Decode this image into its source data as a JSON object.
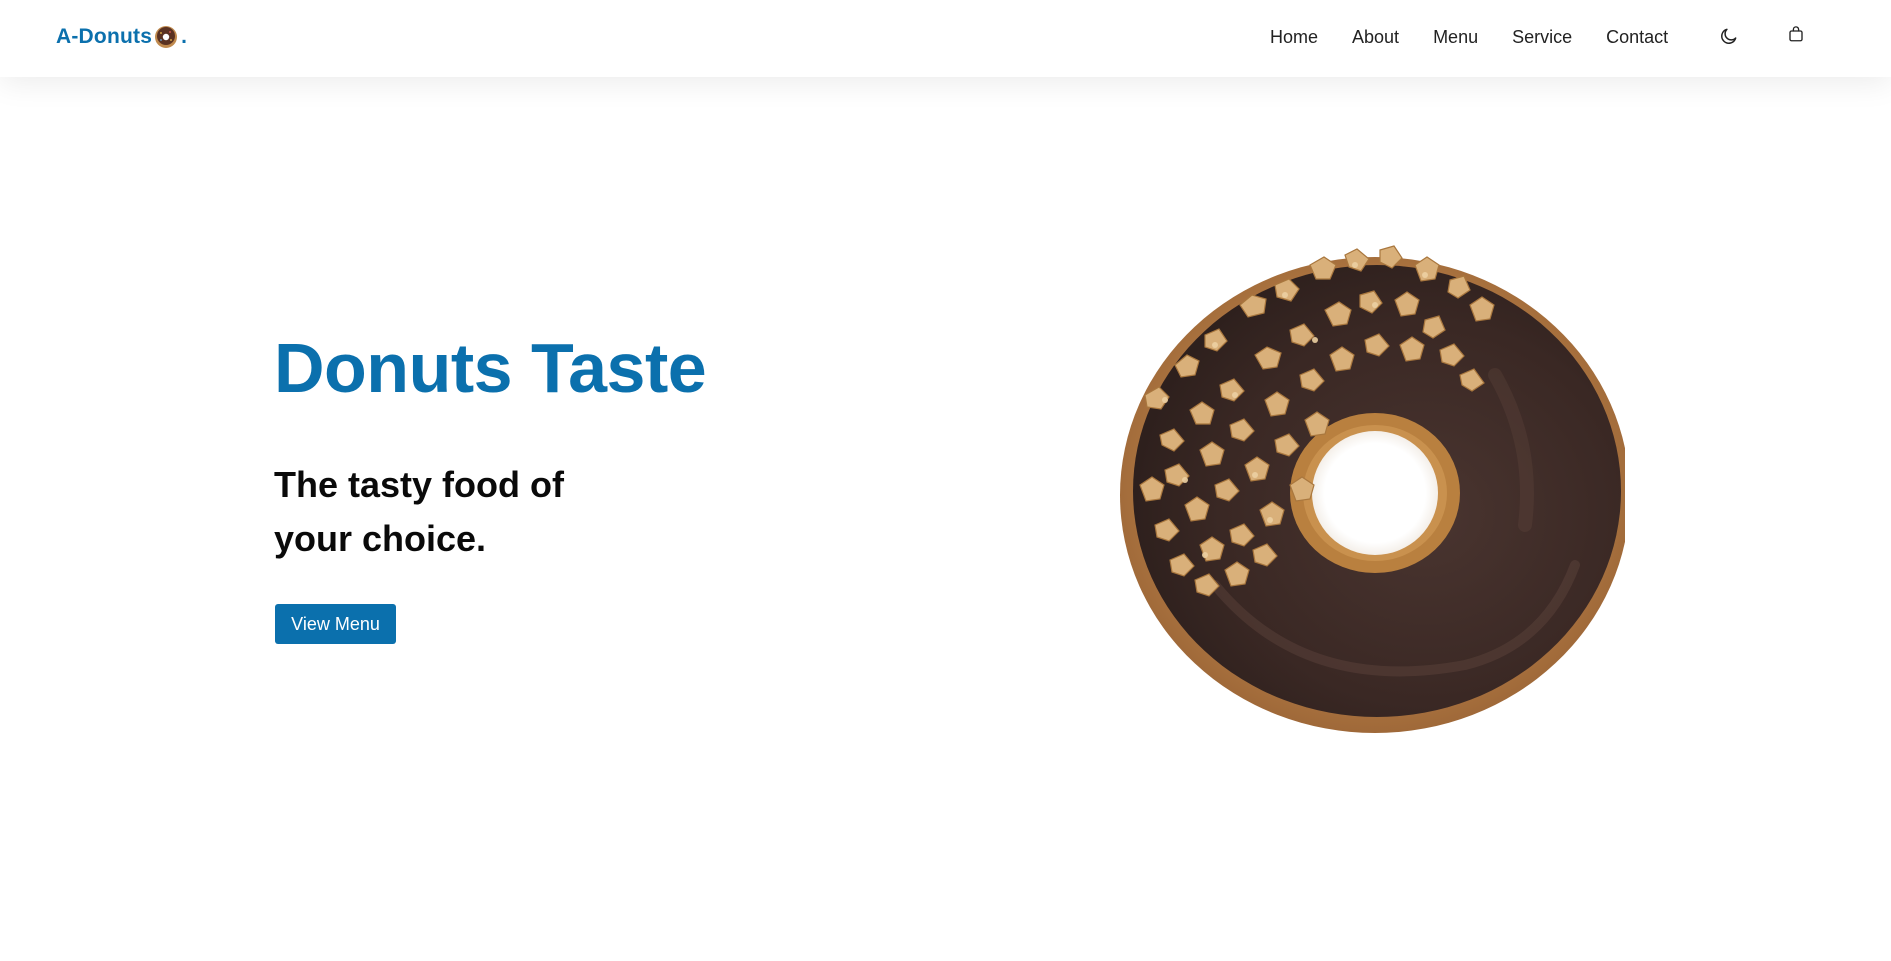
{
  "header": {
    "logo": {
      "text": "A-Donuts",
      "suffix": "."
    },
    "nav": [
      {
        "label": "Home"
      },
      {
        "label": "About"
      },
      {
        "label": "Menu"
      },
      {
        "label": "Service"
      },
      {
        "label": "Contact"
      }
    ],
    "icons": {
      "theme_toggle": "moon-icon",
      "cart": "shopping-bag-icon"
    }
  },
  "hero": {
    "title": "Donuts Taste",
    "subtitle_line1": "The tasty food of",
    "subtitle_line2": "your choice.",
    "cta_label": "View Menu",
    "image": "chocolate-donut-with-nuts"
  },
  "colors": {
    "brand": "#0b70ad",
    "text": "#0a0a0a",
    "background": "#ffffff",
    "chocolate": "#3b2a26",
    "dough": "#c08a4e",
    "nuts": "#d9b07a"
  }
}
